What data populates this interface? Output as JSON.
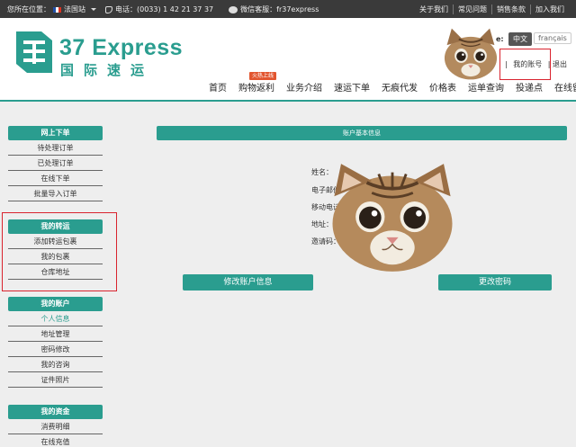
{
  "topbar": {
    "location_label": "您所在位置：",
    "region": "法国站",
    "phone": "电话：(0033) 1 42 21 37 37",
    "wechat": "微信客服：fr37express",
    "links": [
      "关于我们",
      "常见问题",
      "销售条款",
      "加入我们"
    ]
  },
  "logo": {
    "en": "37 Express",
    "cn": "国际速运"
  },
  "lang": {
    "label": "e:",
    "zh": "中文",
    "fr": "français"
  },
  "account": {
    "my_account": "我的账号",
    "sep": "|",
    "logout": "退出"
  },
  "nav": {
    "items": [
      "首页",
      "购物返利",
      "业务介绍",
      "速运下单",
      "无痕代发",
      "价格表",
      "运单查询",
      "投递点",
      "在线留言"
    ],
    "hot_badge": "火热上线"
  },
  "sidebar": {
    "sections": [
      {
        "title": "网上下单",
        "items": [
          "待处理订单",
          "已处理订单",
          "在线下单",
          "批量导入订单"
        ]
      },
      {
        "title": "我的转运",
        "items": [
          "添加转运包裹",
          "我的包裹",
          "仓库地址"
        ]
      },
      {
        "title": "我的账户",
        "items": [
          "个人信息",
          "地址管理",
          "密码修改",
          "我的咨询",
          "证件照片"
        ]
      },
      {
        "title": "我的资金",
        "items": [
          "消费明细",
          "在线充值"
        ]
      }
    ]
  },
  "main": {
    "title": "账户基本信息",
    "fields": [
      "姓名：",
      "电子邮件",
      "移动电话",
      "地址：",
      "邀请码："
    ],
    "edit_button": "修改账户信息",
    "password_button": "更改密码"
  },
  "colors": {
    "accent": "#2a9d8f",
    "highlight": "#d9232e",
    "dark": "#3a3a3a"
  }
}
